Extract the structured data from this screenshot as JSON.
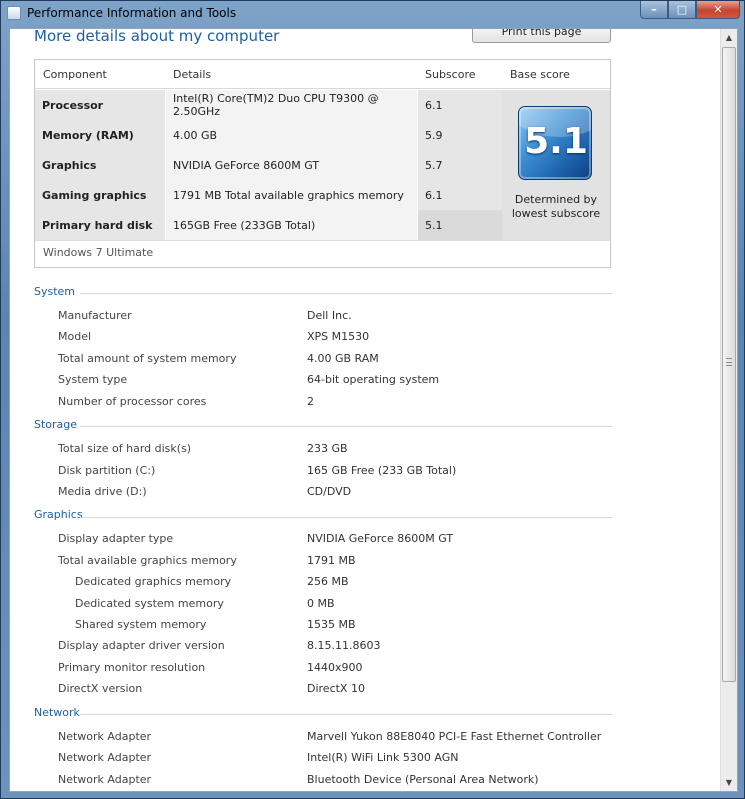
{
  "window": {
    "title": "Performance Information and Tools"
  },
  "header": {
    "link": "More details about my computer",
    "print_button": "Print this page"
  },
  "scores": {
    "columns": [
      "Component",
      "Details",
      "Subscore",
      "Base score"
    ],
    "rows": [
      {
        "component": "Processor",
        "details": "Intel(R) Core(TM)2 Duo CPU T9300 @ 2.50GHz",
        "subscore": "6.1"
      },
      {
        "component": "Memory (RAM)",
        "details": "4.00 GB",
        "subscore": "5.9"
      },
      {
        "component": "Graphics",
        "details": "NVIDIA GeForce 8600M GT",
        "subscore": "5.7"
      },
      {
        "component": "Gaming graphics",
        "details": "1791 MB Total available graphics memory",
        "subscore": "6.1"
      },
      {
        "component": "Primary hard disk",
        "details": "165GB Free (233GB Total)",
        "subscore": "5.1"
      }
    ],
    "base_score": "5.1",
    "base_note_line1": "Determined by",
    "base_note_line2": "lowest subscore",
    "edition": "Windows 7 Ultimate"
  },
  "sections": {
    "system": {
      "title": "System",
      "items": [
        {
          "label": "Manufacturer",
          "value": "Dell Inc."
        },
        {
          "label": "Model",
          "value": "XPS M1530"
        },
        {
          "label": "Total amount of system memory",
          "value": "4.00 GB RAM"
        },
        {
          "label": "System type",
          "value": "64-bit operating system"
        },
        {
          "label": "Number of processor cores",
          "value": "2"
        }
      ]
    },
    "storage": {
      "title": "Storage",
      "items": [
        {
          "label": "Total size of hard disk(s)",
          "value": "233 GB"
        },
        {
          "label": "Disk partition (C:)",
          "value": "165 GB Free (233 GB Total)"
        },
        {
          "label": "Media drive (D:)",
          "value": "CD/DVD"
        }
      ]
    },
    "graphics": {
      "title": "Graphics",
      "items": [
        {
          "label": "Display adapter type",
          "value": "NVIDIA GeForce 8600M GT"
        },
        {
          "label": "Total available graphics memory",
          "value": "1791 MB"
        },
        {
          "label": "Dedicated graphics memory",
          "value": "256 MB"
        },
        {
          "label": "Dedicated system memory",
          "value": "0 MB"
        },
        {
          "label": "Shared system memory",
          "value": "1535 MB"
        },
        {
          "label": "Display adapter driver version",
          "value": "8.15.11.8603"
        },
        {
          "label": "Primary monitor resolution",
          "value": "1440x900"
        },
        {
          "label": "DirectX version",
          "value": "DirectX 10"
        }
      ]
    },
    "network": {
      "title": "Network",
      "items": [
        {
          "label": "Network Adapter",
          "value": "Marvell Yukon 88E8040 PCI-E Fast Ethernet Controller"
        },
        {
          "label": "Network Adapter",
          "value": "Intel(R) WiFi Link 5300 AGN"
        },
        {
          "label": "Network Adapter",
          "value": "Bluetooth Device (Personal Area Network)"
        }
      ]
    }
  }
}
